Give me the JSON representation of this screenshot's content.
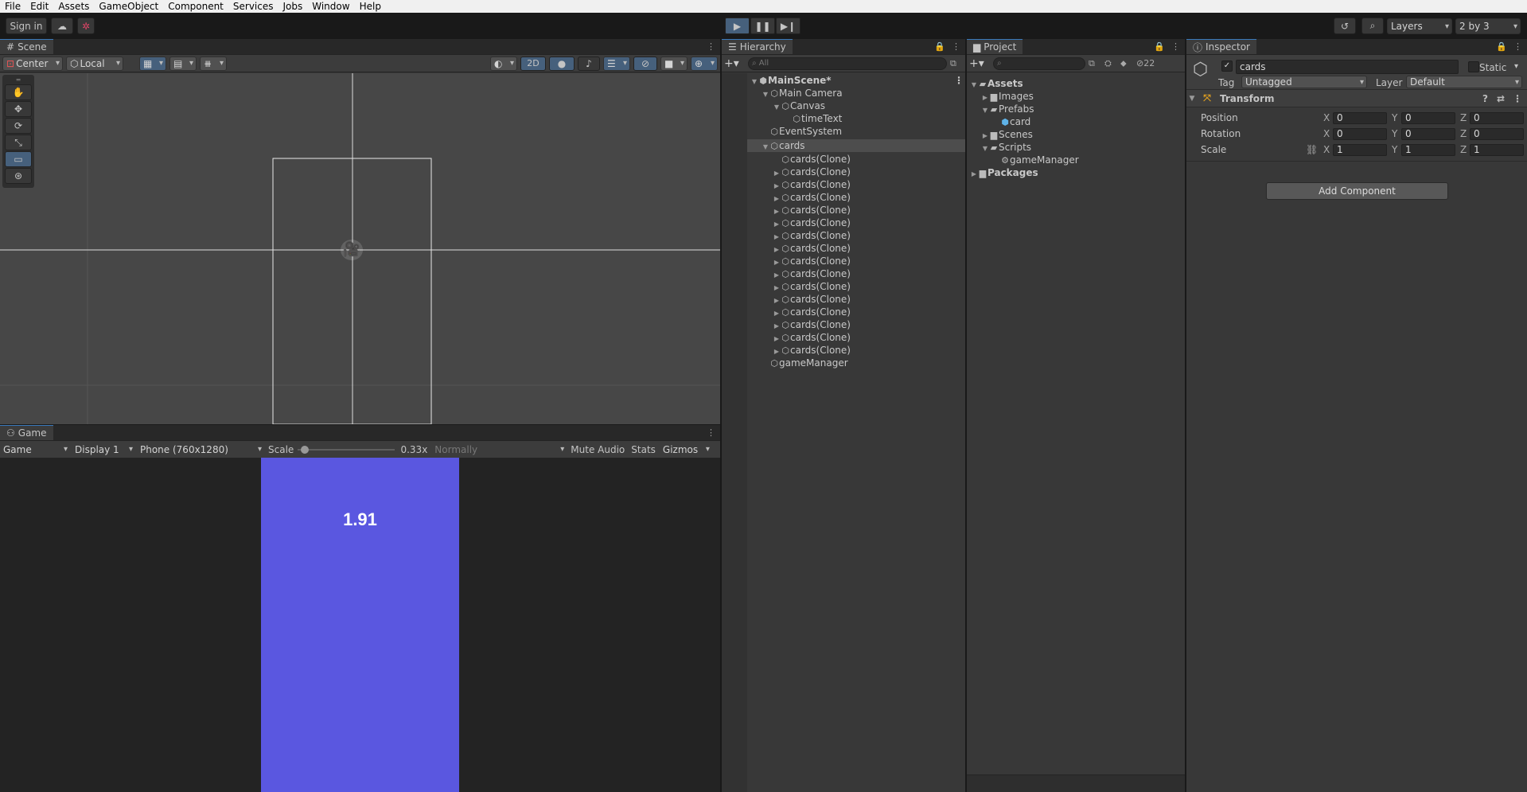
{
  "menu": [
    "File",
    "Edit",
    "Assets",
    "GameObject",
    "Component",
    "Services",
    "Jobs",
    "Window",
    "Help"
  ],
  "toolbar": {
    "sign_in": "Sign in",
    "layers": "Layers",
    "layout": "2 by 3"
  },
  "scene": {
    "tab": "Scene",
    "pivot": "Center",
    "space": "Local",
    "mode_2d": "2D"
  },
  "game": {
    "tab": "Game",
    "view": "Game",
    "display": "Display 1",
    "resolution": "Phone (760x1280)",
    "scale_label": "Scale",
    "scale_value": "0.33x",
    "scale_fraction": 0.03,
    "aspect": "Normally",
    "mute": "Mute Audio",
    "stats": "Stats",
    "gizmos": "Gizmos",
    "timer_text": "1.91",
    "canvas_color": "#5a57e0"
  },
  "hierarchy": {
    "tab": "Hierarchy",
    "search_placeholder": "All",
    "scene_name": "MainScene*",
    "main_camera": "Main Camera",
    "canvas": "Canvas",
    "time_text": "timeText",
    "event_system": "EventSystem",
    "cards": "cards",
    "clones": [
      "cards(Clone)",
      "cards(Clone)",
      "cards(Clone)",
      "cards(Clone)",
      "cards(Clone)",
      "cards(Clone)",
      "cards(Clone)",
      "cards(Clone)",
      "cards(Clone)",
      "cards(Clone)",
      "cards(Clone)",
      "cards(Clone)",
      "cards(Clone)",
      "cards(Clone)",
      "cards(Clone)",
      "cards(Clone)"
    ],
    "game_manager": "gameManager"
  },
  "project": {
    "tab": "Project",
    "hidden_count": "22",
    "assets": "Assets",
    "images": "Images",
    "prefabs": "Prefabs",
    "card": "card",
    "scenes": "Scenes",
    "scripts": "Scripts",
    "game_manager_script": "gameManager",
    "packages": "Packages"
  },
  "inspector": {
    "tab": "Inspector",
    "object_name": "cards",
    "static_label": "Static",
    "tag_label": "Tag",
    "tag_value": "Untagged",
    "layer_label": "Layer",
    "layer_value": "Default",
    "component": "Transform",
    "position_label": "Position",
    "rotation_label": "Rotation",
    "scale_label": "Scale",
    "axis_x": "X",
    "axis_y": "Y",
    "axis_z": "Z",
    "position": [
      "0",
      "0",
      "0"
    ],
    "rotation": [
      "0",
      "0",
      "0"
    ],
    "scale": [
      "1",
      "1",
      "1"
    ],
    "add_component": "Add Component"
  }
}
